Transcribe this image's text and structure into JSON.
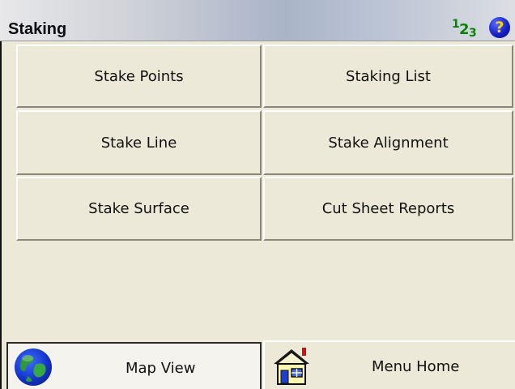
{
  "window": {
    "title": "Staking"
  },
  "header": {
    "keypad_icon": "numeric-123-icon",
    "keypad_digits": [
      "1",
      "2",
      "3"
    ],
    "help_icon": "help-question-icon",
    "help_glyph": "?"
  },
  "menu": {
    "buttons": [
      {
        "label": "Stake Points"
      },
      {
        "label": "Staking List"
      },
      {
        "label": "Stake Line"
      },
      {
        "label": "Stake Alignment"
      },
      {
        "label": "Stake Surface"
      },
      {
        "label": "Cut Sheet Reports"
      }
    ]
  },
  "footer": {
    "map_view": {
      "label": "Map View",
      "icon": "globe-icon"
    },
    "menu_home": {
      "label": "Menu Home",
      "icon": "house-icon"
    }
  }
}
